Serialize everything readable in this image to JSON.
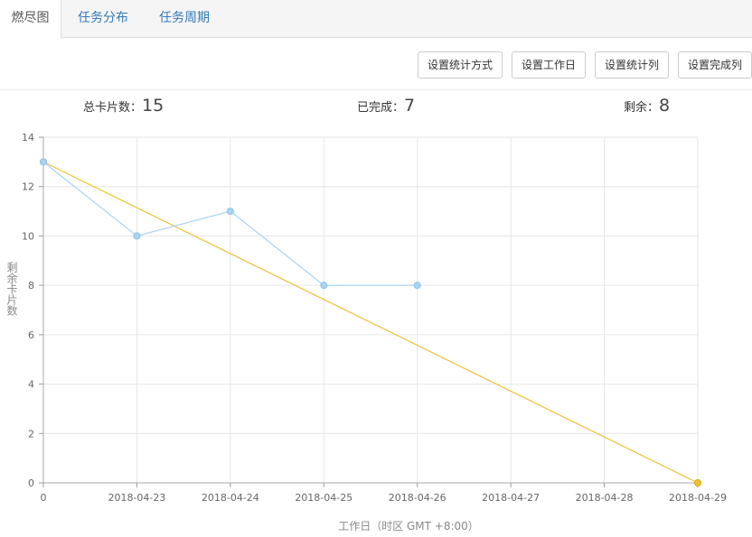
{
  "tabs": [
    {
      "label": "燃尽图",
      "active": true
    },
    {
      "label": "任务分布",
      "active": false
    },
    {
      "label": "任务周期",
      "active": false
    }
  ],
  "toolbar": {
    "buttons": [
      "设置统计方式",
      "设置工作日",
      "设置统计列",
      "设置完成列"
    ]
  },
  "stats": [
    {
      "label": "总卡片数：",
      "value": "15"
    },
    {
      "label": "已完成：",
      "value": "7"
    },
    {
      "label": "剩余：",
      "value": "8"
    }
  ],
  "colors": {
    "actual_line": "#a9d4f2",
    "actual_point": "#a9d4f2",
    "ideal_line": "#efc13a",
    "grid": "#e6e6e6",
    "tab_link": "#337ab7"
  },
  "chart_data": {
    "type": "line",
    "categories": [
      "0",
      "2018-04-23",
      "2018-04-24",
      "2018-04-25",
      "2018-04-26",
      "2018-04-27",
      "2018-04-28",
      "2018-04-29"
    ],
    "series": [
      {
        "values": [
          13,
          10,
          11,
          8,
          8,
          null,
          null,
          null
        ]
      },
      {
        "values": [
          13,
          null,
          null,
          null,
          null,
          null,
          null,
          0
        ]
      }
    ],
    "ylabel": "剩余卡片数",
    "xlabel": "工作日（时区 GMT +8:00）",
    "ylim": [
      0,
      14
    ],
    "yticks": [
      0,
      2,
      4,
      6,
      8,
      10,
      12,
      14
    ],
    "grid": true
  }
}
